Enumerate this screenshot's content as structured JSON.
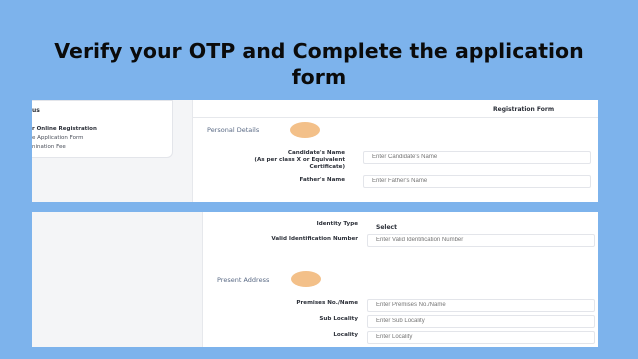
{
  "slide": {
    "title_line1": "Verify your OTP and Complete the application",
    "title_line2": "form"
  },
  "left_card": {
    "title": "us",
    "items": [
      "r Online Registration",
      "e Application Form",
      "nination Fee"
    ]
  },
  "form": {
    "heading": "Registration Form",
    "sections": {
      "personal": "Personal Details",
      "address": "Present Address"
    },
    "fields": {
      "candidate_name": {
        "label_lines": [
          "Candidate's Name",
          "(As per class X or Equivalent",
          "Certificate)"
        ],
        "placeholder": "Enter Candidate's Name"
      },
      "father_name": {
        "label": "Father's Name",
        "placeholder": "Enter Father's Name"
      },
      "identity_type": {
        "label": "Identity Type",
        "value": "Select"
      },
      "valid_id_number": {
        "label": "Valid Identification Number",
        "placeholder": "Enter Valid Identification Number"
      },
      "premises": {
        "label": "Premises No./Name",
        "placeholder": "Enter Premises No./Name"
      },
      "sub_locality": {
        "label": "Sub Locality",
        "placeholder": "Enter Sub Locality"
      },
      "locality": {
        "label": "Locality",
        "placeholder": "Enter Locality"
      }
    }
  },
  "colors": {
    "background": "#7db3ec",
    "highlight": "#f2b97c",
    "section_label": "#5a6a85"
  }
}
